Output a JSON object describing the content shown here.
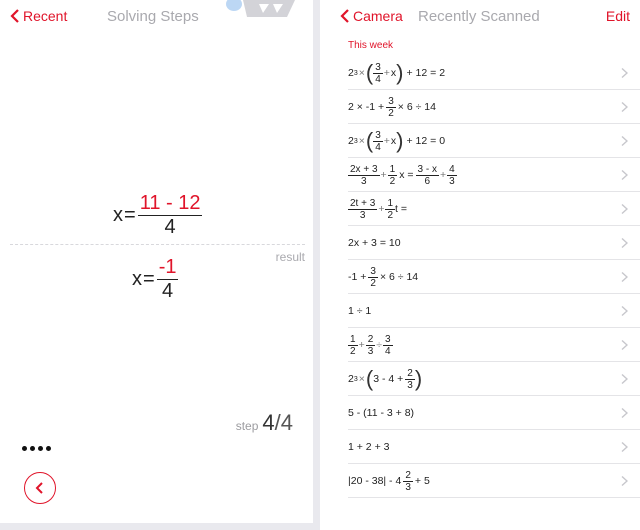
{
  "left_screen": {
    "nav": {
      "back_label": "Recent",
      "title": "Solving Steps"
    },
    "equation": {
      "lhs": "x",
      "op": "=",
      "numerator": "11 - 12",
      "denominator": "4"
    },
    "result_label": "result",
    "result": {
      "lhs": "x",
      "op": "=",
      "numerator": "-1",
      "denominator": "4"
    },
    "step": {
      "label": "step",
      "current": "4",
      "separator": "/",
      "total": "4"
    }
  },
  "right_screen": {
    "nav": {
      "back_label": "Camera",
      "title": "Recently Scanned",
      "edit_label": "Edit"
    },
    "section_label": "This week",
    "rows": [
      {
        "a": "2",
        "a_sup": "3",
        "times": "×",
        "n": "3",
        "d": "4",
        "plus": "+",
        "x": "x",
        "tail": "+ 12 = 2"
      },
      {
        "text1": "2 × -1 +",
        "n": "3",
        "d": "2",
        "tail": "× 6 ÷ 14"
      },
      {
        "a": "2",
        "a_sup": "3",
        "times": "×",
        "n": "3",
        "d": "4",
        "plus": "+",
        "x": "x",
        "tail": "+ 12 = 0"
      },
      {
        "n1": "2x + 3",
        "d1": "3",
        "p1": "+",
        "n2": "1",
        "d2": "2",
        "mid": "x =",
        "n3": "3 - x",
        "d3": "6",
        "p3": "+",
        "n4": "4",
        "d4": "3"
      },
      {
        "n1": "2t + 3",
        "d1": "3",
        "p1": "+",
        "n2": "1",
        "d2": "2",
        "tail": "t ="
      },
      {
        "text": "2x + 3 = 10"
      },
      {
        "text1": "-1 +",
        "n": "3",
        "d": "2",
        "tail": "× 6 ÷ 14"
      },
      {
        "text": "1 ÷ 1"
      },
      {
        "n1": "1",
        "d1": "2",
        "p1": "+",
        "n2": "2",
        "d2": "3",
        "p2": "÷",
        "n3": "3",
        "d3": "4"
      },
      {
        "a": "2",
        "a_sup": "3",
        "times": "×",
        "inner": "3 - 4 +",
        "n": "2",
        "d": "3"
      },
      {
        "text": "5 - (11 - 3 + 8)"
      },
      {
        "text": "1 + 2 + 3"
      },
      {
        "text1": "|20 - 38| - 4",
        "n": "2",
        "d": "3",
        "tail": "+ 5"
      }
    ]
  },
  "colors": {
    "accent": "#e0142a",
    "muted": "#a9a9ae"
  },
  "icons": [
    "chevron-left-icon",
    "chevron-right-icon",
    "back-circle-icon",
    "more-dots-icon"
  ]
}
